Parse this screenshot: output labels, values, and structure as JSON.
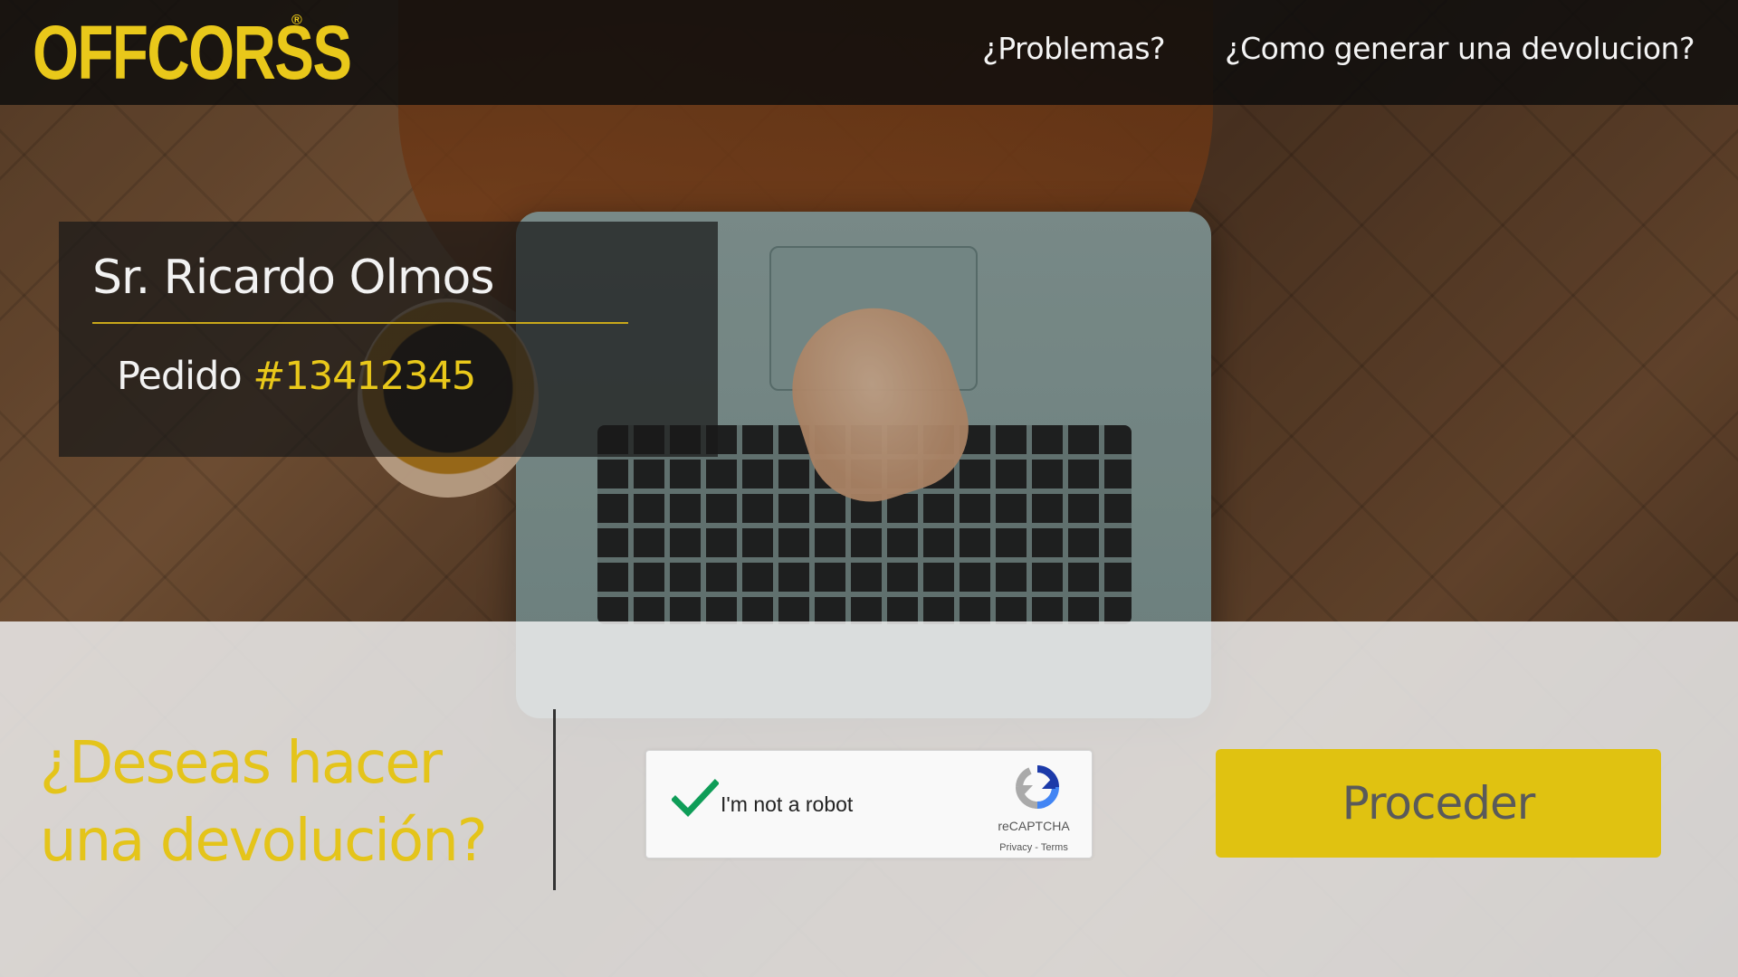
{
  "header": {
    "logo_text": "OFFCORSS",
    "logo_mark": "®",
    "nav": [
      {
        "label": "¿Problemas?"
      },
      {
        "label": "¿Como generar una devolucion?"
      }
    ]
  },
  "customer": {
    "name": "Sr. Ricardo Olmos",
    "order_prefix": "Pedido",
    "order_number": "#13412345"
  },
  "action": {
    "question": "¿Deseas hacer una devolución?",
    "recaptcha": {
      "label": "I'm not a robot",
      "brand": "reCAPTCHA",
      "privacy": "Privacy",
      "separator": "-",
      "terms": "Terms",
      "checked": true
    },
    "proceed_label": "Proceder"
  },
  "colors": {
    "brand_yellow": "#e9c81a",
    "button_yellow": "#e0c211",
    "header_bg": "#0c0c0c",
    "check_green": "#0f9d58"
  }
}
